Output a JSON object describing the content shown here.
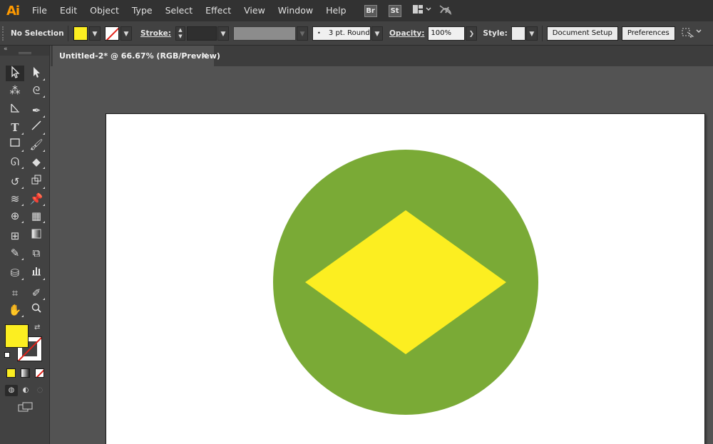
{
  "menubar": {
    "logo": "Ai",
    "items": [
      "File",
      "Edit",
      "Object",
      "Type",
      "Select",
      "Effect",
      "View",
      "Window",
      "Help"
    ],
    "bridge_label": "Br",
    "stock_label": "St",
    "workspace_icon": "arrange-documents-icon",
    "gpu_icon": "gpu-performance-icon"
  },
  "controlbar": {
    "selection_label": "No Selection",
    "fill_color": "#fcee21",
    "stroke_color": "none",
    "stroke_label": "Stroke:",
    "brush_label": "3 pt. Round",
    "opacity_label": "Opacity:",
    "opacity_value": "100%",
    "style_label": "Style:",
    "document_setup_label": "Document Setup",
    "preferences_label": "Preferences"
  },
  "tools": {
    "fill_color": "#fcee21",
    "stroke_color": "none",
    "items": [
      "selection-tool",
      "direct-selection-tool",
      "magic-wand-tool",
      "lasso-tool",
      "line-segment-tool",
      "pen-tool",
      "type-tool",
      "line-tool",
      "rectangle-tool",
      "paintbrush-tool",
      "shaper-tool",
      "eraser-tool",
      "rotate-tool",
      "scale-tool",
      "width-tool",
      "puppet-warp-tool",
      "shape-builder-tool",
      "perspective-grid-tool",
      "mesh-tool",
      "gradient-tool",
      "eyedropper-tool",
      "blend-tool",
      "symbol-sprayer-tool",
      "column-graph-tool",
      "artboard-tool",
      "slice-tool",
      "hand-tool",
      "zoom-tool"
    ]
  },
  "document": {
    "tab_title": "Untitled-2* @ 66.67% (RGB/Preview)",
    "close_glyph": "×"
  },
  "artwork": {
    "circle_color": "#7aaa36",
    "diamond_color": "#fcee21",
    "artboard_color": "#ffffff"
  }
}
